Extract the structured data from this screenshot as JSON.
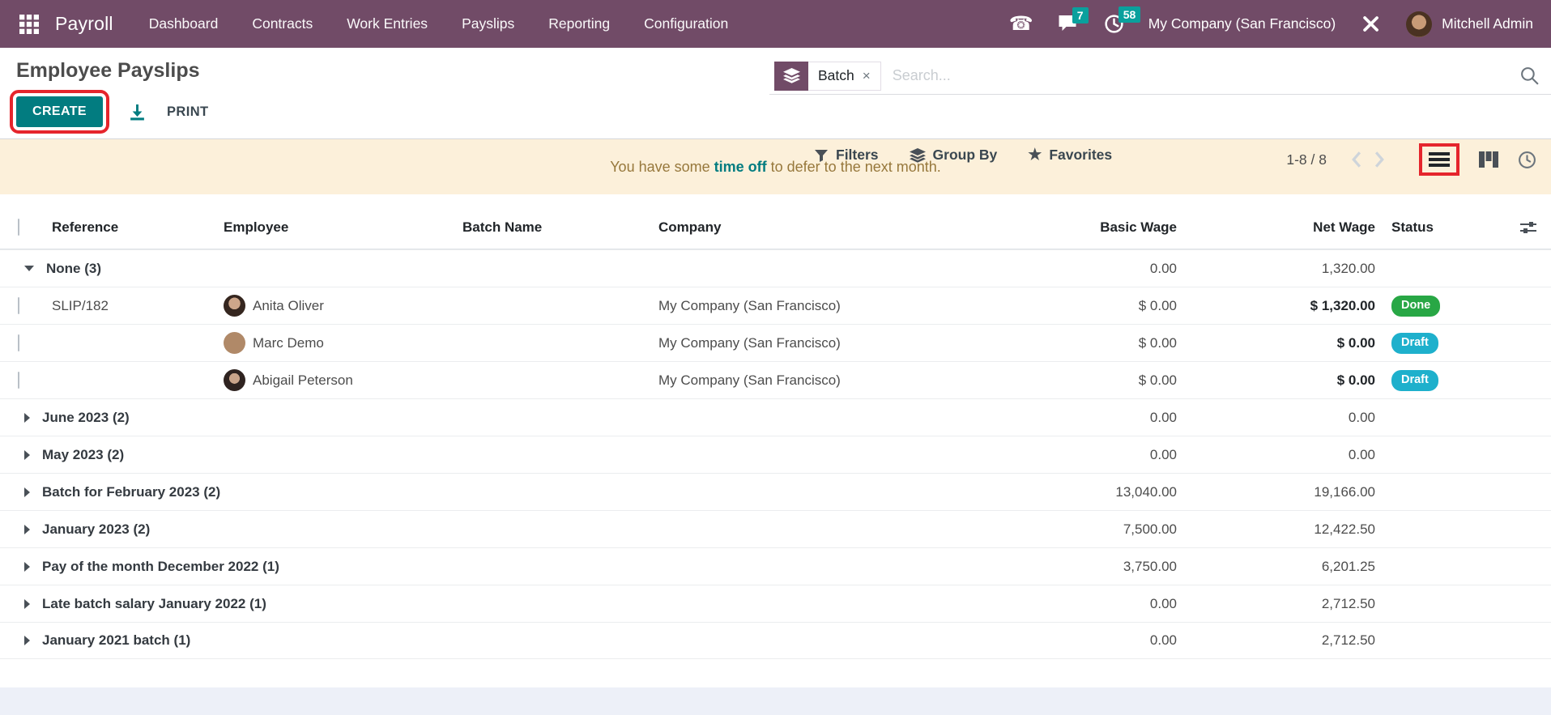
{
  "topbar": {
    "app_name": "Payroll",
    "menus": [
      "Dashboard",
      "Contracts",
      "Work Entries",
      "Payslips",
      "Reporting",
      "Configuration"
    ],
    "messages_badge": "7",
    "activities_badge": "58",
    "company": "My Company (San Francisco)",
    "user": "Mitchell Admin"
  },
  "control_panel": {
    "title": "Employee Payslips",
    "create_label": "CREATE",
    "print_label": "PRINT",
    "search": {
      "facet_label": "Batch",
      "placeholder": "Search..."
    },
    "filters_label": "Filters",
    "groupby_label": "Group By",
    "favorites_label": "Favorites",
    "pager_text": "1-8 / 8"
  },
  "banner": {
    "text_before": "You have some",
    "link_label": "time off",
    "text_after": "to defer to the next month."
  },
  "icons": {
    "close": "×",
    "star": "★",
    "phone": "☎"
  },
  "table": {
    "headers": [
      "Reference",
      "Employee",
      "Batch Name",
      "Company",
      "Basic Wage",
      "Net Wage",
      "Status"
    ],
    "status_colors": {
      "Done": "#28a745",
      "Draft": "#1eb0cc"
    },
    "rows": [
      {
        "type": "group",
        "label": "None (3)",
        "expanded": true,
        "basic": "0.00",
        "net": "1,320.00"
      },
      {
        "type": "record",
        "reference": "SLIP/182",
        "employee": "Anita Oliver",
        "avatar": "anita",
        "company": "My Company (San Francisco)",
        "basic": "$ 0.00",
        "net": "$ 1,320.00",
        "status": "Done"
      },
      {
        "type": "record",
        "reference": "",
        "employee": "Marc Demo",
        "avatar": "marc",
        "company": "My Company (San Francisco)",
        "basic": "$ 0.00",
        "net": "$ 0.00",
        "status": "Draft"
      },
      {
        "type": "record",
        "reference": "",
        "employee": "Abigail Peterson",
        "avatar": "abigail",
        "company": "My Company (San Francisco)",
        "basic": "$ 0.00",
        "net": "$ 0.00",
        "status": "Draft"
      },
      {
        "type": "group",
        "label": "June 2023 (2)",
        "expanded": false,
        "basic": "0.00",
        "net": "0.00"
      },
      {
        "type": "group",
        "label": "May 2023 (2)",
        "expanded": false,
        "basic": "0.00",
        "net": "0.00"
      },
      {
        "type": "group",
        "label": "Batch for February 2023 (2)",
        "expanded": false,
        "basic": "13,040.00",
        "net": "19,166.00"
      },
      {
        "type": "group",
        "label": "January 2023 (2)",
        "expanded": false,
        "basic": "7,500.00",
        "net": "12,422.50"
      },
      {
        "type": "group",
        "label": "Pay of the month December 2022 (1)",
        "expanded": false,
        "basic": "3,750.00",
        "net": "6,201.25"
      },
      {
        "type": "group",
        "label": "Late batch salary January 2022 (1)",
        "expanded": false,
        "basic": "0.00",
        "net": "2,712.50"
      },
      {
        "type": "group",
        "label": "January 2021 batch (1)",
        "expanded": false,
        "basic": "0.00",
        "net": "2,712.50"
      }
    ]
  }
}
